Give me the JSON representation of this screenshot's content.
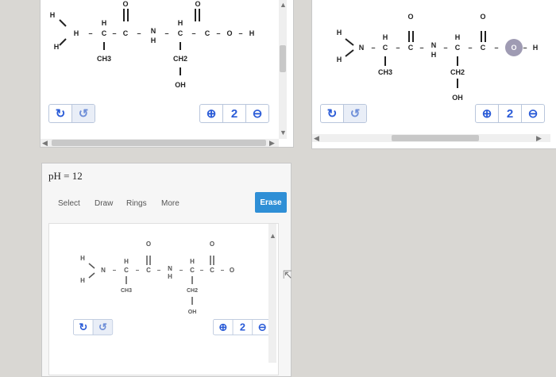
{
  "colors": {
    "accent": "#2a5bd7",
    "erase_bg": "#2f8fd6",
    "highlight": "#8e8aa6"
  },
  "panel_top_left": {
    "controls": {
      "undo_icon": "↻",
      "redo_icon": "↺",
      "zoom_in_icon": "⊕",
      "reset_icon": "2",
      "zoom_out_icon": "⊖"
    }
  },
  "panel_top_right": {
    "controls": {
      "undo_icon": "↻",
      "redo_icon": "↺",
      "zoom_in_icon": "⊕",
      "reset_icon": "2",
      "zoom_out_icon": "⊖"
    }
  },
  "panel_bottom": {
    "ph_label": "pH = 12",
    "tabs": [
      "Select",
      "Draw",
      "Rings",
      "More"
    ],
    "erase_label": "Erase",
    "controls": {
      "undo_icon": "↻",
      "redo_icon": "↺",
      "zoom_in_icon": "⊕",
      "reset_icon": "2",
      "zoom_out_icon": "⊖"
    }
  },
  "molecule_atoms": {
    "O": "O",
    "H": "H",
    "C": "C",
    "N": "N",
    "CH3": "CH3",
    "CH2": "CH2",
    "OH": "OH",
    "dash": "–"
  }
}
